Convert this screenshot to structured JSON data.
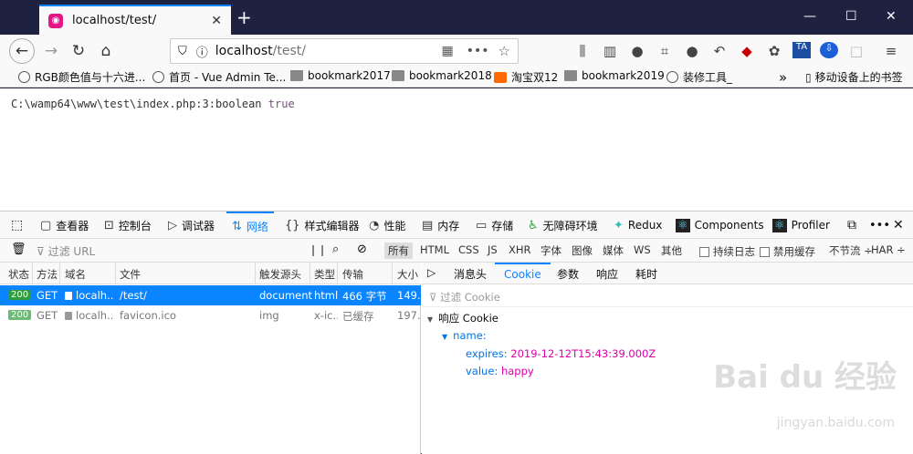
{
  "browser": {
    "tab_title": "localhost/test/",
    "url_host": "localhost",
    "url_path": "/test/",
    "window_controls": {
      "minimize": "—",
      "maximize": "☐",
      "close": "✕"
    }
  },
  "bookmarks": [
    {
      "label": "RGB颜色值与十六进...",
      "icon": "globe-icon"
    },
    {
      "label": "首页 - Vue Admin Te...",
      "icon": "globe-icon"
    },
    {
      "label": "bookmark2017",
      "icon": "folder-icon"
    },
    {
      "label": "bookmark2018",
      "icon": "folder-icon"
    },
    {
      "label": "淘宝双12",
      "icon": "taobao-icon"
    },
    {
      "label": "bookmark2019",
      "icon": "folder-icon"
    },
    {
      "label": "装修工具_",
      "icon": "globe-icon"
    }
  ],
  "bookmarks_more": "»",
  "mobile_bookmarks": "移动设备上的书签",
  "page": {
    "dump_path": "C:\\wamp64\\www\\test\\index.php:3:boolean",
    "dump_value": "true"
  },
  "devtools": {
    "tabs": [
      {
        "label": "查看器",
        "icon": "inspector-icon"
      },
      {
        "label": "控制台",
        "icon": "console-icon"
      },
      {
        "label": "调试器",
        "icon": "debugger-icon"
      },
      {
        "label": "网络",
        "icon": "network-icon"
      },
      {
        "label": "样式编辑器",
        "icon": "style-editor-icon"
      },
      {
        "label": "性能",
        "icon": "performance-icon"
      },
      {
        "label": "内存",
        "icon": "memory-icon"
      },
      {
        "label": "存储",
        "icon": "storage-icon"
      },
      {
        "label": "无障碍环境",
        "icon": "accessibility-icon"
      },
      {
        "label": "Redux",
        "icon": "redux-icon"
      },
      {
        "label": "Components",
        "icon": "react-icon"
      },
      {
        "label": "Profiler",
        "icon": "react-icon"
      }
    ],
    "active_tab": "网络",
    "filter_placeholder": "过滤 URL",
    "filter_types": [
      "所有",
      "HTML",
      "CSS",
      "JS",
      "XHR",
      "字体",
      "图像",
      "媒体",
      "WS",
      "其他"
    ],
    "persist_logs": "持续日志",
    "disable_cache": "禁用缓存",
    "throttle": "不节流 ÷",
    "har": "HAR ÷",
    "columns": [
      "状态",
      "方法",
      "域名",
      "文件",
      "触发源头",
      "类型",
      "传输",
      "大小"
    ],
    "requests": [
      {
        "status": "200",
        "method": "GET",
        "domain": "localh...",
        "file": "/test/",
        "cause": "document",
        "type": "html",
        "transferred": "466 字节",
        "size": "149..."
      },
      {
        "status": "200",
        "method": "GET",
        "domain": "localh...",
        "file": "favicon.ico",
        "cause": "img",
        "type": "x-ic...",
        "transferred": "已缓存",
        "size": "197..."
      }
    ],
    "detail_tabs": [
      "消息头",
      "Cookie",
      "参数",
      "响应",
      "耗时"
    ],
    "detail_active": "Cookie",
    "cookie_filter_placeholder": "过滤 Cookie",
    "response_cookie_title": "响应 Cookie",
    "cookie": {
      "name_key": "name:",
      "expires_key": "expires:",
      "expires_value": "2019-12-12T15:43:39.000Z",
      "value_key": "value:",
      "value_value": "happy"
    }
  },
  "watermark": {
    "main": "Bai du 经验",
    "sub": "jingyan.baidu.com"
  },
  "colors": {
    "accent": "#0a84ff",
    "status_ok": "#2e9e3d",
    "title_bar": "#1f2140",
    "cookie_string": "#dd00a9"
  }
}
